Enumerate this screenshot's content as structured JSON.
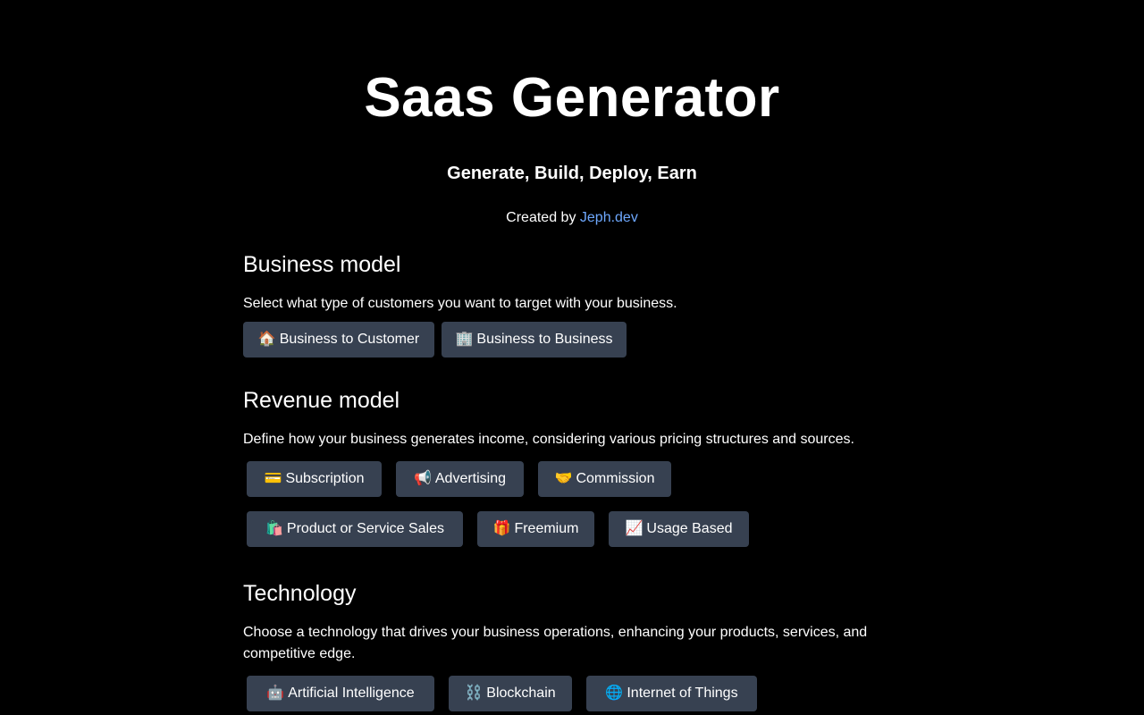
{
  "header": {
    "title": "Saas Generator",
    "tagline": "Generate, Build, Deploy, Earn",
    "credit_prefix": "Created by ",
    "credit_link": "Jeph.dev"
  },
  "sections": [
    {
      "title": "Business model",
      "description": "Select what type of customers you want to target with your business.",
      "options": [
        {
          "icon": "🏠",
          "label": "Business to Customer"
        },
        {
          "icon": "🏢",
          "label": "Business to Business"
        }
      ]
    },
    {
      "title": "Revenue model",
      "description": "Define how your business generates income, considering various pricing structures and sources.",
      "options": [
        {
          "icon": "💳",
          "label": "Subscription"
        },
        {
          "icon": "📢",
          "label": "Advertising"
        },
        {
          "icon": "🤝",
          "label": "Commission"
        },
        {
          "icon": "🛍️",
          "label": "Product or Service Sales"
        },
        {
          "icon": "🎁",
          "label": "Freemium"
        },
        {
          "icon": "📈",
          "label": "Usage Based"
        }
      ]
    },
    {
      "title": "Technology",
      "description": "Choose a technology that drives your business operations, enhancing your products, services, and competitive edge.",
      "options": [
        {
          "icon": "🤖",
          "label": "Artificial Intelligence"
        },
        {
          "icon": "⛓️",
          "label": "Blockchain"
        },
        {
          "icon": "🌐",
          "label": "Internet of Things"
        }
      ]
    }
  ],
  "colors": {
    "background": "#000000",
    "chip": "#374151",
    "link": "#6ea8fe"
  }
}
